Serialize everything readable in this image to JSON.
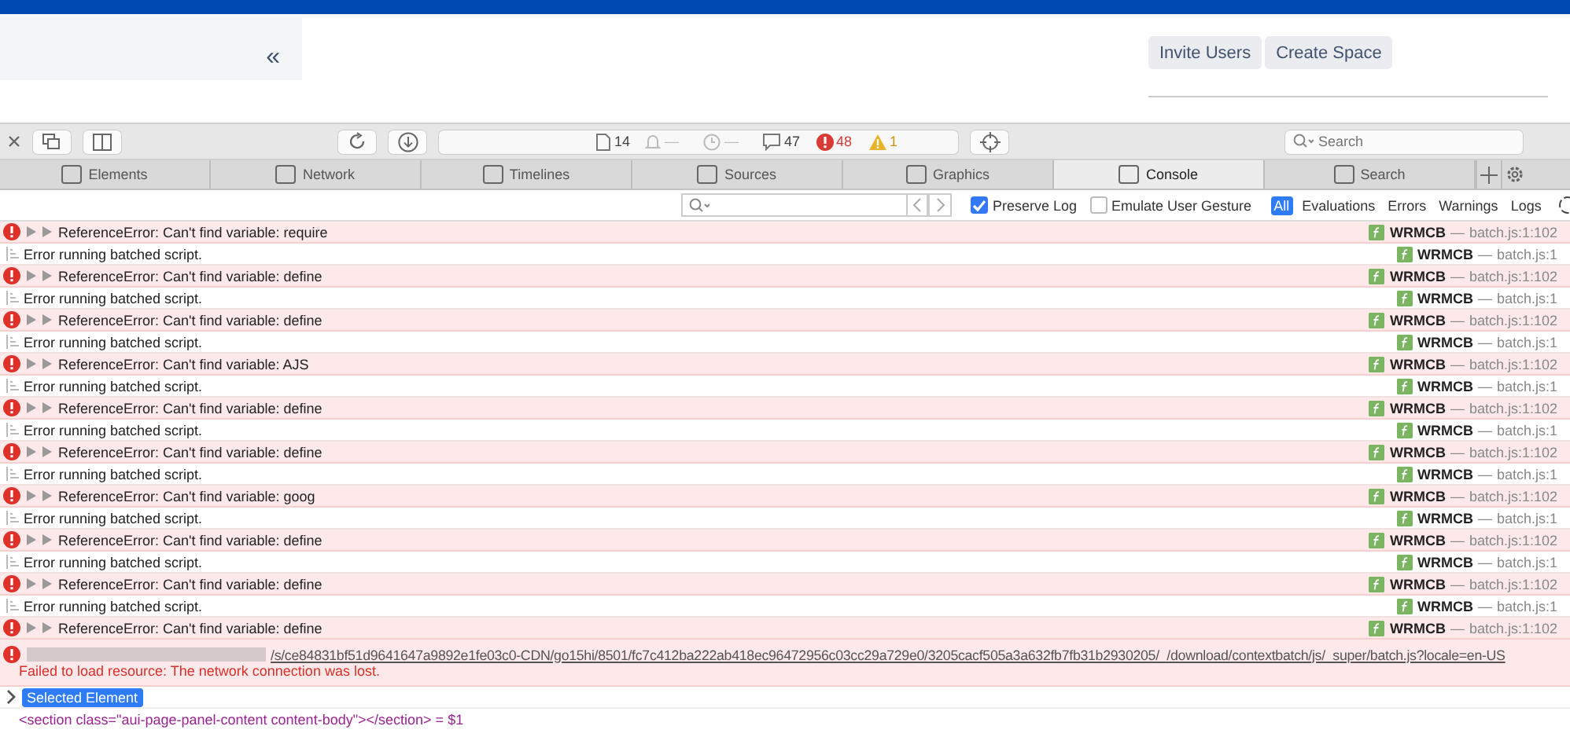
{
  "page": {
    "buttons": [
      "Invite Users",
      "Create Space"
    ],
    "collapse_icon": "«"
  },
  "toolbar": {
    "resources": "14",
    "pending": "—",
    "time": "—",
    "messages": "47",
    "errors": "48",
    "warnings": "1",
    "search": {
      "placeholder": "Search"
    }
  },
  "tabs": [
    {
      "label": "Elements",
      "selected": false
    },
    {
      "label": "Network",
      "selected": false
    },
    {
      "label": "Timelines",
      "selected": false
    },
    {
      "label": "Sources",
      "selected": false
    },
    {
      "label": "Graphics",
      "selected": false
    },
    {
      "label": "Console",
      "selected": true
    },
    {
      "label": "Search",
      "selected": false
    }
  ],
  "filter_bar": {
    "preserve_log": {
      "label": "Preserve Log",
      "checked": true
    },
    "emulate_gesture": {
      "label": "Emulate User Gesture",
      "checked": false
    },
    "levels": [
      {
        "label": "All",
        "selected": true
      },
      {
        "label": "Evaluations",
        "selected": false
      },
      {
        "label": "Errors",
        "selected": false
      },
      {
        "label": "Warnings",
        "selected": false
      },
      {
        "label": "Logs",
        "selected": false
      }
    ]
  },
  "source_separator": "—",
  "log": [
    {
      "kind": "error",
      "message": "ReferenceError: Can't find variable: require",
      "function": "WRMCB",
      "location": "batch.js:1:102"
    },
    {
      "kind": "log",
      "message": "Error running batched script.",
      "function": "WRMCB",
      "location": "batch.js:1"
    },
    {
      "kind": "error",
      "message": "ReferenceError: Can't find variable: define",
      "function": "WRMCB",
      "location": "batch.js:1:102"
    },
    {
      "kind": "log",
      "message": "Error running batched script.",
      "function": "WRMCB",
      "location": "batch.js:1"
    },
    {
      "kind": "error",
      "message": "ReferenceError: Can't find variable: define",
      "function": "WRMCB",
      "location": "batch.js:1:102"
    },
    {
      "kind": "log",
      "message": "Error running batched script.",
      "function": "WRMCB",
      "location": "batch.js:1"
    },
    {
      "kind": "error",
      "message": "ReferenceError: Can't find variable: AJS",
      "function": "WRMCB",
      "location": "batch.js:1:102"
    },
    {
      "kind": "log",
      "message": "Error running batched script.",
      "function": "WRMCB",
      "location": "batch.js:1"
    },
    {
      "kind": "error",
      "message": "ReferenceError: Can't find variable: define",
      "function": "WRMCB",
      "location": "batch.js:1:102"
    },
    {
      "kind": "log",
      "message": "Error running batched script.",
      "function": "WRMCB",
      "location": "batch.js:1"
    },
    {
      "kind": "error",
      "message": "ReferenceError: Can't find variable: define",
      "function": "WRMCB",
      "location": "batch.js:1:102"
    },
    {
      "kind": "log",
      "message": "Error running batched script.",
      "function": "WRMCB",
      "location": "batch.js:1"
    },
    {
      "kind": "error",
      "message": "ReferenceError: Can't find variable: goog",
      "function": "WRMCB",
      "location": "batch.js:1:102"
    },
    {
      "kind": "log",
      "message": "Error running batched script.",
      "function": "WRMCB",
      "location": "batch.js:1"
    },
    {
      "kind": "error",
      "message": "ReferenceError: Can't find variable: define",
      "function": "WRMCB",
      "location": "batch.js:1:102"
    },
    {
      "kind": "log",
      "message": "Error running batched script.",
      "function": "WRMCB",
      "location": "batch.js:1"
    },
    {
      "kind": "error",
      "message": "ReferenceError: Can't find variable: define",
      "function": "WRMCB",
      "location": "batch.js:1:102"
    },
    {
      "kind": "log",
      "message": "Error running batched script.",
      "function": "WRMCB",
      "location": "batch.js:1"
    },
    {
      "kind": "error",
      "message": "ReferenceError: Can't find variable: define",
      "function": "WRMCB",
      "location": "batch.js:1:102"
    },
    {
      "kind": "resource",
      "url": "/s/ce84831bf51d9641647a9892e1fe03c0-CDN/go15hi/8501/fc7c412ba222ab418ec96472956c03cc29a729e0/3205cacf505a3a632fb7fb31b2930205/_/download/contextbatch/js/_super/batch.js?locale=en-US",
      "message": "Failed to load resource: The network connection was lost."
    }
  ],
  "selected_element": {
    "label": "Selected Element",
    "code": "<section class=\"aui-page-panel-content content-body\"></section> = $1"
  }
}
